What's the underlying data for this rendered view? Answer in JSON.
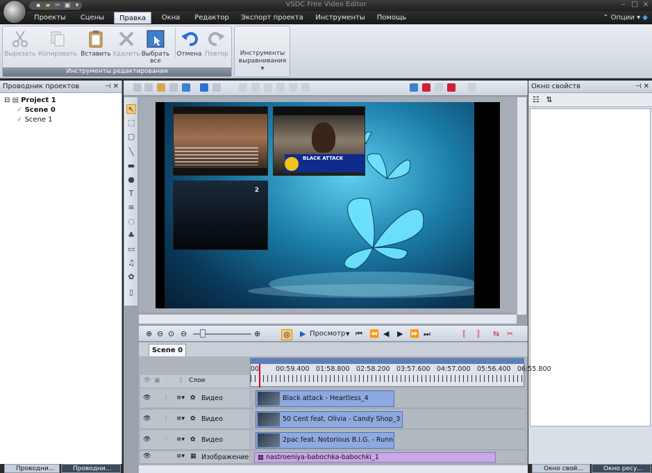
{
  "window": {
    "title": "VSDC Free Video Editor"
  },
  "menu": {
    "items": [
      "Проекты",
      "Сцены",
      "Правка",
      "Окна",
      "Редактор",
      "Экспорт проекта",
      "Инструменты",
      "Помощь"
    ],
    "active_index": 2,
    "options_label": "Опции"
  },
  "ribbon": {
    "edit_buttons": [
      {
        "label": "Вырезать",
        "enabled": false
      },
      {
        "label": "Копировать",
        "enabled": false
      },
      {
        "label": "Вставить",
        "enabled": true
      },
      {
        "label": "Удалить",
        "enabled": false
      },
      {
        "label": "Выбрать все",
        "enabled": true
      },
      {
        "label": "Отмена",
        "enabled": true
      },
      {
        "label": "Повтор",
        "enabled": false
      }
    ],
    "edit_group_title": "Инструменты редактирования",
    "align_button": "Инструменты выравнивания"
  },
  "project_explorer": {
    "title": "Проводник проектов",
    "project": "Project 1",
    "scenes": [
      "Scene 0",
      "Scene 1"
    ]
  },
  "properties": {
    "title": "Окно свойств"
  },
  "preview": {
    "thumbnails": [
      {
        "name": "thumb-1"
      },
      {
        "name": "thumb-2",
        "caption": "BLACK ATTACK"
      },
      {
        "name": "thumb-3",
        "badge": "2"
      }
    ]
  },
  "playback": {
    "preview_label": "Просмотр"
  },
  "timeline": {
    "scene_tab": "Scene 0",
    "layers_label": "Слои",
    "timecodes": [
      "00",
      "00:59.400",
      "01:58.800",
      "02:58.200",
      "03:57.600",
      "04:57.000",
      "05:56.400",
      "06:55.800"
    ],
    "tracks": [
      {
        "type": "Видео",
        "clip": "Black attack - Heartless_4"
      },
      {
        "type": "Видео",
        "clip": "50 Cent feat. Olivia - Candy Shop_3"
      },
      {
        "type": "Видео",
        "clip": "2pac feat. Notorious B.I.G. - Runnin"
      },
      {
        "type": "Изображение",
        "clip": "nastroeniya-babochka-babochki_1"
      }
    ]
  },
  "bottom_tabs": {
    "left": [
      "Проводни...",
      "Проводни..."
    ],
    "right": [
      "Окно свой...",
      "Окно ресу..."
    ]
  }
}
